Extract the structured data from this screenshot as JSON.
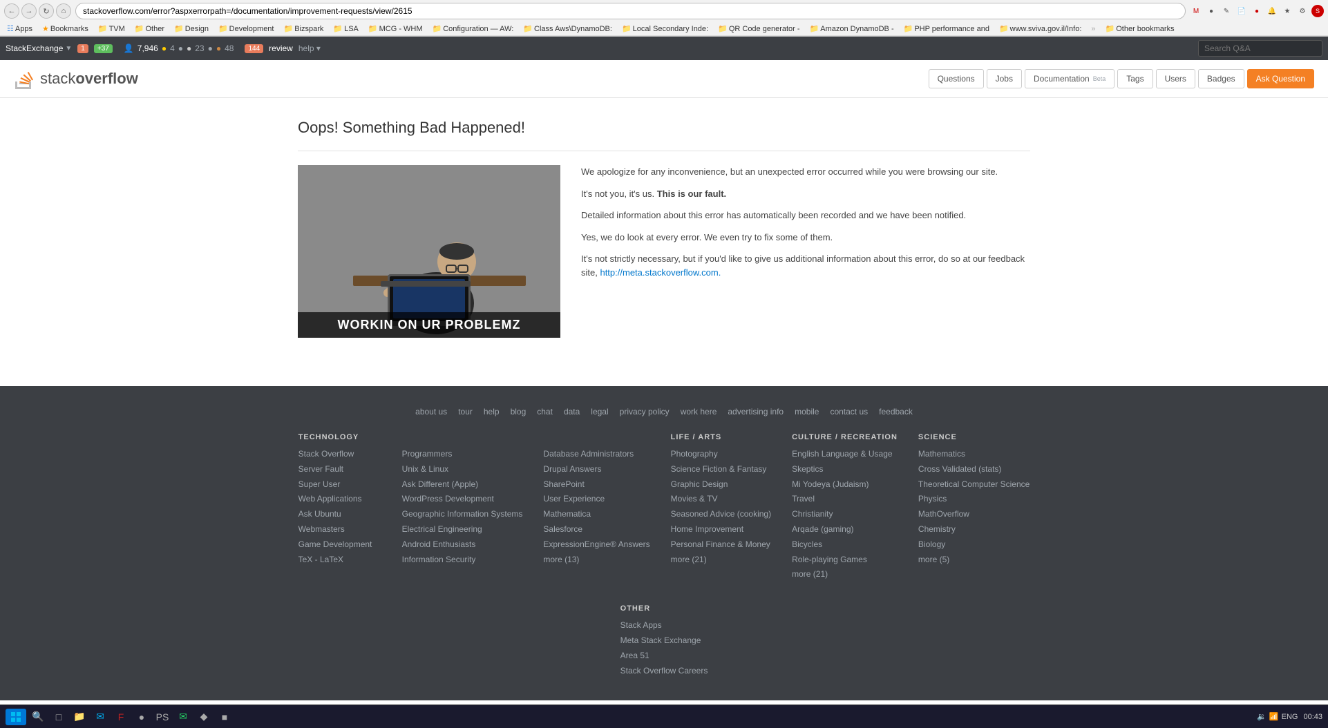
{
  "browser": {
    "url": "stackoverflow.com/error?aspxerrorpath=/documentation/improvement-requests/view/2615",
    "back_btn": "←",
    "forward_btn": "→",
    "reload_btn": "↺",
    "home_btn": "⌂"
  },
  "bookmarks": {
    "items": [
      {
        "label": "Apps",
        "icon": "apps"
      },
      {
        "label": "Bookmarks",
        "icon": "star"
      },
      {
        "label": "TVM",
        "icon": "folder"
      },
      {
        "label": "Other",
        "icon": "folder"
      },
      {
        "label": "Design",
        "icon": "folder"
      },
      {
        "label": "Development",
        "icon": "folder"
      },
      {
        "label": "Bizspark",
        "icon": "folder"
      },
      {
        "label": "LSA",
        "icon": "folder"
      },
      {
        "label": "MCG - WHM",
        "icon": "folder"
      },
      {
        "label": "Configuration — AW:",
        "icon": "folder"
      },
      {
        "label": "Class Aws\\DynamoDB:",
        "icon": "folder"
      },
      {
        "label": "Local Secondary Inde:",
        "icon": "folder"
      },
      {
        "label": "QR Code generator -",
        "icon": "folder"
      },
      {
        "label": "Amazon DynamoDB -",
        "icon": "folder"
      },
      {
        "label": "PHP performance and",
        "icon": "folder"
      },
      {
        "label": "www.sviva.gov.il/Info:",
        "icon": "folder"
      },
      {
        "label": "Other bookmarks",
        "icon": "folder"
      }
    ]
  },
  "se_bar": {
    "logo": "StackExchange",
    "notification_count": "1",
    "reputation_delta": "+37",
    "user_icon": "👤",
    "reputation": "7,946",
    "badges": {
      "gold": "4",
      "silver": "23",
      "bronze": "48"
    },
    "review_badge": "144",
    "review": "review",
    "help": "help ▾",
    "search_placeholder": "Search Q&A"
  },
  "so_header": {
    "logo_text_part1": "stack",
    "logo_text_part2": "overflow",
    "nav": {
      "questions": "Questions",
      "jobs": "Jobs",
      "documentation": "Documentation",
      "documentation_badge": "Beta",
      "tags": "Tags",
      "users": "Users",
      "badges": "Badges",
      "ask_question": "Ask Question"
    }
  },
  "error_page": {
    "title": "Oops! Something Bad Happened!",
    "image_caption": "WORKIN ON UR PROBLEMZ",
    "paragraphs": [
      "We apologize for any inconvenience, but an unexpected error occurred while you were browsing our site.",
      "It's not you, it's us. This is our fault.",
      "Detailed information about this error has automatically been recorded and we have been notified.",
      "Yes, we do look at every error. We even try to fix some of them.",
      "It's not strictly necessary, but if you'd like to give us additional information about this error, do so at our feedback site, http://meta.stackoverflow.com."
    ],
    "feedback_link": "http://meta.stackoverflow.com."
  },
  "footer": {
    "links": [
      {
        "label": "about us"
      },
      {
        "label": "tour"
      },
      {
        "label": "help"
      },
      {
        "label": "blog"
      },
      {
        "label": "chat"
      },
      {
        "label": "data"
      },
      {
        "label": "legal"
      },
      {
        "label": "privacy policy"
      },
      {
        "label": "work here"
      },
      {
        "label": "advertising info"
      },
      {
        "label": "mobile"
      },
      {
        "label": "contact us"
      },
      {
        "label": "feedback"
      }
    ],
    "columns": [
      {
        "title": "TECHNOLOGY",
        "items": [
          "Stack Overflow",
          "Server Fault",
          "Super User",
          "Web Applications",
          "Ask Ubuntu",
          "Webmasters",
          "Game Development",
          "TeX - LaTeX"
        ]
      },
      {
        "title": "",
        "items": [
          "Programmers",
          "Unix & Linux",
          "Ask Different (Apple)",
          "WordPress Development",
          "Geographic Information Systems",
          "Electrical Engineering",
          "Android Enthusiasts",
          "Information Security"
        ]
      },
      {
        "title": "",
        "items": [
          "Database Administrators",
          "Drupal Answers",
          "SharePoint",
          "User Experience",
          "Mathematica",
          "Salesforce",
          "ExpressionEngine® Answers",
          "more (13)"
        ]
      },
      {
        "title": "LIFE / ARTS",
        "items": [
          "Photography",
          "Science Fiction & Fantasy",
          "Graphic Design",
          "Movies & TV",
          "Seasoned Advice (cooking)",
          "Home Improvement",
          "Personal Finance & Money"
        ],
        "more": "more (21)"
      },
      {
        "title": "CULTURE / RECREATION",
        "items": [
          "English Language & Usage",
          "Skeptics",
          "Mi Yodeya (Judaism)",
          "Travel",
          "Christianity",
          "Arqade (gaming)",
          "Bicycles",
          "Role-playing Games"
        ],
        "more": "more (21)"
      },
      {
        "title": "SCIENCE",
        "items": [
          "Mathematics",
          "Cross Validated (stats)",
          "Theoretical Computer Science",
          "Physics",
          "MathOverflow",
          "Chemistry",
          "Biology"
        ],
        "more": "more (5)"
      },
      {
        "title": "OTHER",
        "items": [
          "Stack Apps",
          "Meta Stack Exchange",
          "Area 51",
          "Stack Overflow Careers"
        ]
      }
    ]
  },
  "taskbar": {
    "time": "00:43",
    "lang": "ENG"
  }
}
